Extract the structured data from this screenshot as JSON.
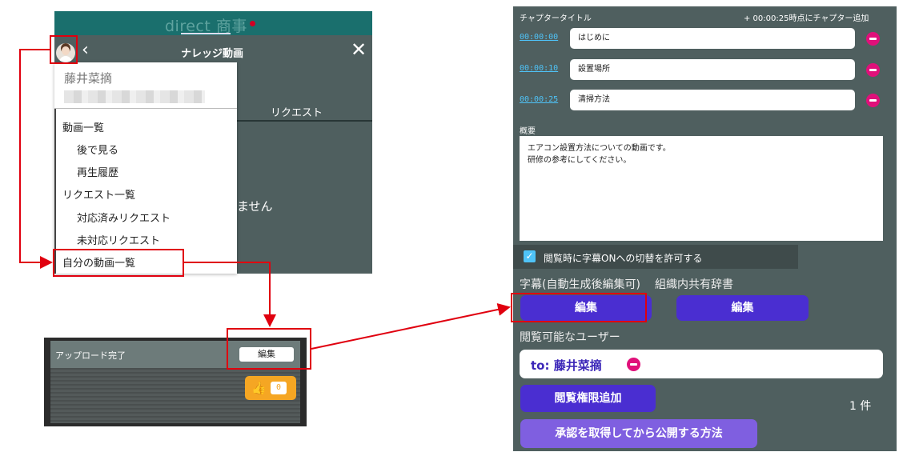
{
  "panel_app": {
    "brand": "direct 商事",
    "title": "ナレッジ動画",
    "back_icon": "‹",
    "close_icon": "✕",
    "tab_request": "リクエスト",
    "empty_text": "ません"
  },
  "menu": {
    "user_name": "藤井菜摘",
    "items": [
      "動画一覧",
      "後で見る",
      "再生履歴",
      "リクエスト一覧",
      "対応済みリクエスト",
      "未対応リクエスト",
      "自分の動画一覧"
    ]
  },
  "upload_card": {
    "status": "アップロード完了",
    "edit_label": "編集",
    "like_count": "0",
    "like_icon": "thumbs-up"
  },
  "edit_form": {
    "chapter_header": "チャプタータイトル",
    "add_chapter": "+ 00:00:25時点にチャプター追加",
    "chapters": [
      {
        "time": "00:00:00",
        "title": "はじめに"
      },
      {
        "time": "00:00:10",
        "title": "設置場所"
      },
      {
        "time": "00:00:25",
        "title": "清掃方法"
      }
    ],
    "summary_label": "概要",
    "summary_text": "エアコン設置方法についての動画です。\n研修の参考にしてください。",
    "subtitle_toggle_label": "閲覧時に字幕ONへの切替を許可する",
    "subtitle_section": "字幕(自動生成後編集可)",
    "dictionary_section": "組織内共有辞書",
    "edit_subtitle_button": "編集",
    "edit_dictionary_button": "編集",
    "viewers_section": "閲覧可能なユーザー",
    "viewer": "to: 藤井菜摘",
    "add_permission_button": "閲覧権限追加",
    "viewer_count": "1 件",
    "approval_button": "承認を取得してから公開する方法"
  },
  "colors": {
    "highlight": "#e0000f",
    "panel_bg": "#4f5f5f",
    "purple_button": "#4a2ed1",
    "remove_button": "#e0107a",
    "link_time": "#4fc3f7"
  }
}
